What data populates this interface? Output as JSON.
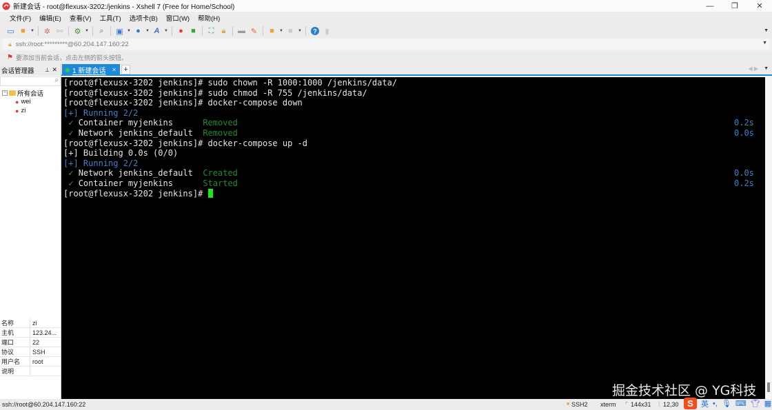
{
  "window": {
    "title": "新建会话 - root@flexusx-3202:/jenkins - Xshell 7 (Free for Home/School)",
    "controls": [
      "minimize",
      "restore",
      "close"
    ]
  },
  "menu": [
    "文件(F)",
    "编辑(E)",
    "查看(V)",
    "工具(T)",
    "选项卡(B)",
    "窗口(W)",
    "帮助(H)"
  ],
  "toolbar": {
    "icons": [
      "new-session-icon",
      "open-folder-icon",
      "connect-icon",
      "disconnect-icon",
      "session-props-icon",
      "find-icon",
      "transfer-icon",
      "globe-icon",
      "font-icon",
      "xshell-icon",
      "xftp-icon",
      "fullscreen-icon",
      "lock-icon",
      "keyboard-icon",
      "highlight-icon",
      "new-tab-icon",
      "layout-icon",
      "help-icon",
      "chat-icon"
    ]
  },
  "address": {
    "value": "ssh://root:*********@60.204.147.160:22"
  },
  "hint": "要添加当前会话，点击左侧的箭头按钮。",
  "session_manager": {
    "title": "会话管理器",
    "search_placeholder": "",
    "tree": {
      "root": "所有会话",
      "children": [
        "wei",
        "zi"
      ]
    },
    "properties": [
      {
        "key": "名称",
        "value": "zi"
      },
      {
        "key": "主机",
        "value": "123.24..."
      },
      {
        "key": "端口",
        "value": "22"
      },
      {
        "key": "协议",
        "value": "SSH"
      },
      {
        "key": "用户名",
        "value": "root"
      },
      {
        "key": "说明",
        "value": ""
      }
    ]
  },
  "tabs": [
    {
      "label": "1 新建会话",
      "active": true,
      "status_color": "#2ecc40"
    }
  ],
  "terminal": {
    "lines": [
      {
        "prompt": "[root@flexusx-3202 jenkins]# ",
        "cmd": "sudo chown -R 1000:1000 /jenkins/data/"
      },
      {
        "prompt": "[root@flexusx-3202 jenkins]# ",
        "cmd": "sudo chmod -R 755 /jenkins/data/"
      },
      {
        "prompt": "[root@flexusx-3202 jenkins]# ",
        "cmd": "docker-compose down"
      },
      {
        "blue": "[+] Running 2/2"
      },
      {
        "check": " ✓ ",
        "name": "Container myjenkins      ",
        "status": "Removed",
        "time": "0.2s"
      },
      {
        "check": " ✓ ",
        "name": "Network jenkins_default  ",
        "status": "Removed",
        "time": "0.0s"
      },
      {
        "prompt": "[root@flexusx-3202 jenkins]# ",
        "cmd": "docker-compose up -d"
      },
      {
        "plain": "[+] Building 0.0s (0/0)"
      },
      {
        "blue": "[+] Running 2/2"
      },
      {
        "check": " ✓ ",
        "name": "Network jenkins_default  ",
        "status": "Created",
        "time": "0.0s"
      },
      {
        "check": " ✓ ",
        "name": "Container myjenkins      ",
        "status": "Started",
        "time": "0.2s"
      },
      {
        "prompt": "[root@flexusx-3202 jenkins]# ",
        "cmd": ""
      }
    ]
  },
  "watermark": "掘金技术社区 @ YG科技",
  "statusbar": {
    "connection": "ssh://root@60.204.147.160:22",
    "protocol": "SSH2",
    "term": "xterm",
    "size": "144x31",
    "cursor_pos": "12,30"
  },
  "ime": {
    "logo": "S",
    "lang": "英"
  }
}
